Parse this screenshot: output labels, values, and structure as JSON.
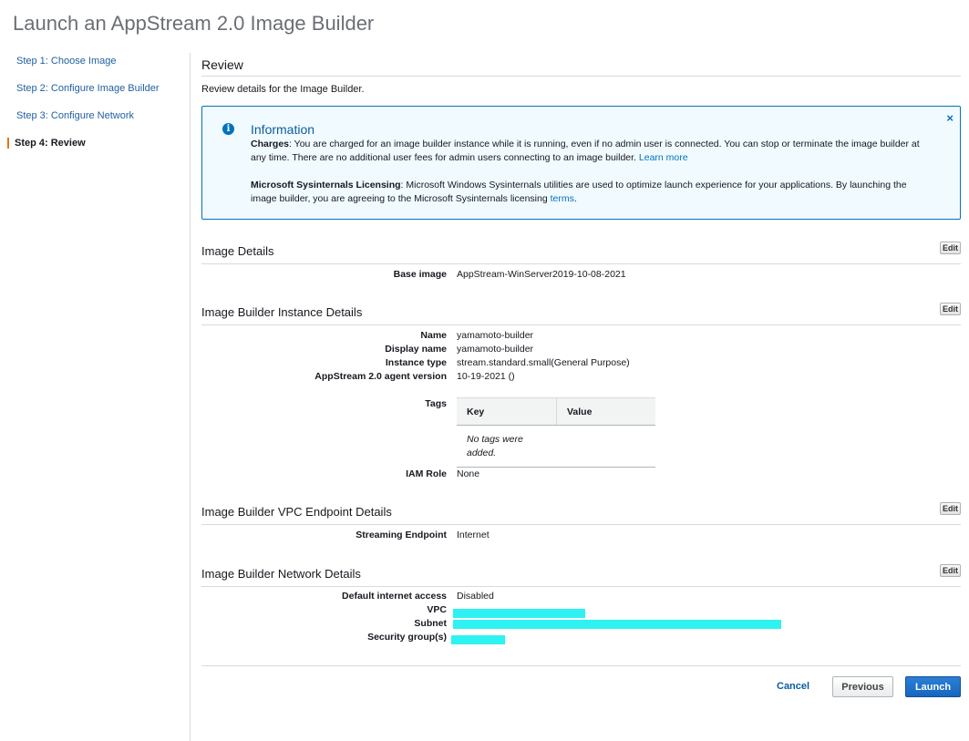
{
  "page_title": "Launch an AppStream 2.0 Image Builder",
  "steps": [
    {
      "label": "Step 1: Choose Image"
    },
    {
      "label": "Step 2: Configure Image Builder"
    },
    {
      "label": "Step 3: Configure Network"
    },
    {
      "label": "Step 4: Review"
    }
  ],
  "review": {
    "title": "Review",
    "description": "Review details for the Image Builder."
  },
  "info": {
    "heading": "Information",
    "charges_label": "Charges",
    "charges_text": ": You are charged for an image builder instance while it is running, even if no admin user is connected. You can stop or terminate the image builder at any time. There are no additional user fees for admin users connecting to an image builder. ",
    "charges_link": "Learn more",
    "licensing_label": "Microsoft Sysinternals Licensing",
    "licensing_text": ": Microsoft Windows Sysinternals utilities are used to optimize launch experience for your applications. By launching the image builder, you are agreeing to the Microsoft Sysinternals licensing ",
    "licensing_link": "terms",
    "licensing_end": ".",
    "close": "×"
  },
  "edit_label": "Edit",
  "image_details": {
    "title": "Image Details",
    "base_image_label": "Base image",
    "base_image": "AppStream-WinServer2019-10-08-2021"
  },
  "instance_details": {
    "title": "Image Builder Instance Details",
    "name_label": "Name",
    "name": "yamamoto-builder",
    "display_name_label": "Display name",
    "display_name": "yamamoto-builder",
    "instance_type_label": "Instance type",
    "instance_type": "stream.standard.small(General Purpose)",
    "agent_version_label": "AppStream 2.0 agent version",
    "agent_version": "10-19-2021 ()",
    "tags_label": "Tags",
    "tags_columns": [
      "Key",
      "Value"
    ],
    "tags_empty": "No tags were added.",
    "iam_role_label": "IAM Role",
    "iam_role": "None"
  },
  "vpc_endpoint": {
    "title": "Image Builder VPC Endpoint Details",
    "streaming_label": "Streaming Endpoint",
    "streaming": "Internet"
  },
  "network": {
    "title": "Image Builder Network Details",
    "internet_label": "Default internet access",
    "internet": "Disabled",
    "vpc_label": "VPC",
    "subnet_label": "Subnet",
    "security_groups_label": "Security group(s)"
  },
  "actions": {
    "cancel": "Cancel",
    "previous": "Previous",
    "launch": "Launch"
  },
  "colors": {
    "accent": "#0073bb",
    "active_step": "#ec7211",
    "redaction": "#2ef2f2",
    "primary_button": "#1566c0"
  }
}
